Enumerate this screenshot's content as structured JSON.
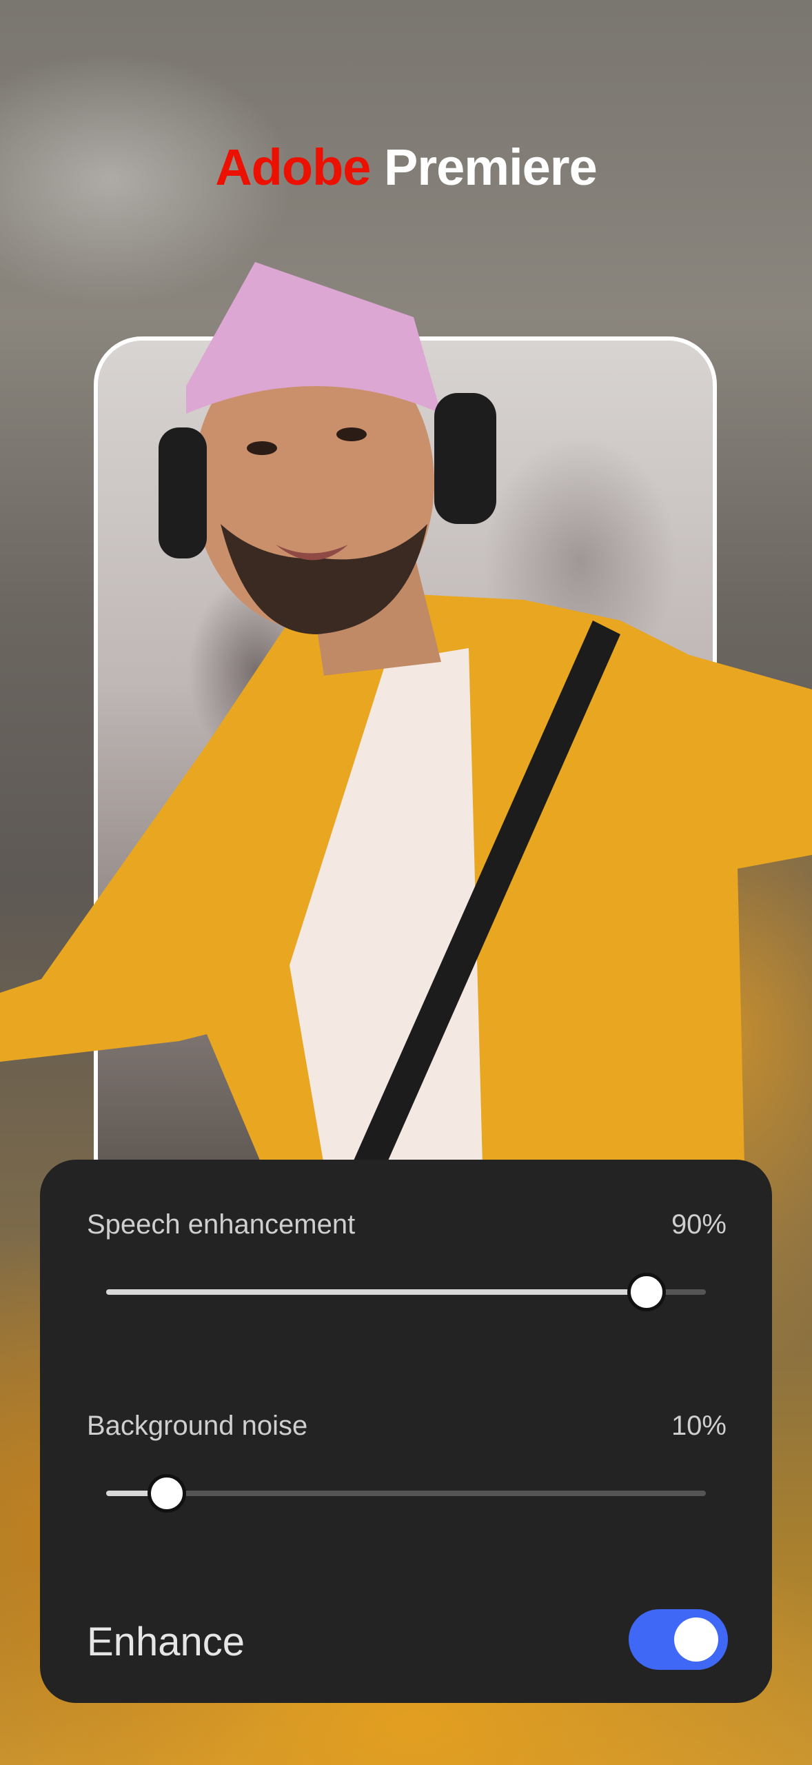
{
  "logo": {
    "brand": "Adobe",
    "product": "Premiere"
  },
  "controls": {
    "speech": {
      "label": "Speech enhancement",
      "value_text": "90%",
      "level": 0.9
    },
    "noise": {
      "label": "Background noise",
      "value_text": "10%",
      "level": 0.1
    },
    "enhance": {
      "label": "Enhance",
      "on": true
    }
  },
  "colors": {
    "brand_red": "#eb1000",
    "toggle_on": "#3f68f6",
    "panel_bg": "#232323"
  }
}
